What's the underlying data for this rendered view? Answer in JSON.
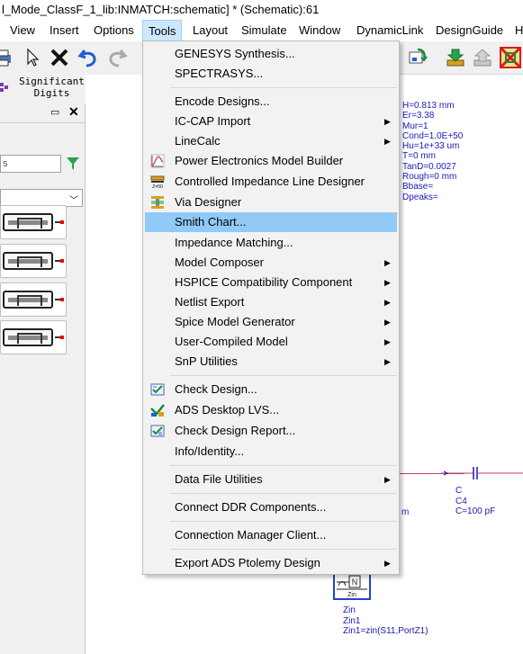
{
  "window": {
    "title": "l_Mode_ClassF_1_lib:INMATCH:schematic] * (Schematic):61"
  },
  "menubar": {
    "items": [
      {
        "label": "View"
      },
      {
        "label": "Insert"
      },
      {
        "label": "Options"
      },
      {
        "label": "Tools"
      },
      {
        "label": "Layout"
      },
      {
        "label": "Simulate"
      },
      {
        "label": "Window"
      },
      {
        "label": "DynamicLink"
      },
      {
        "label": "DesignGuide"
      },
      {
        "label": "H"
      }
    ],
    "active": "Tools"
  },
  "toolbar": {
    "significant_digits_label": "Significant\nDigits"
  },
  "panel": {
    "search_value": "s"
  },
  "tools_menu": {
    "items": [
      {
        "label": "GENESYS Synthesis...",
        "submenu": false
      },
      {
        "label": "SPECTRASYS...",
        "submenu": false
      },
      {
        "label": "Encode Designs...",
        "submenu": false
      },
      {
        "label": "IC-CAP Import",
        "submenu": true
      },
      {
        "label": "LineCalc",
        "submenu": true
      },
      {
        "label": "Power Electronics Model Builder",
        "submenu": false,
        "icon": "power-electronics-icon"
      },
      {
        "label": "Controlled Impedance Line Designer",
        "submenu": false,
        "icon": "impedance-line-icon"
      },
      {
        "label": "Via Designer",
        "submenu": false,
        "icon": "via-designer-icon"
      },
      {
        "label": "Smith Chart...",
        "submenu": false,
        "highlighted": true
      },
      {
        "label": "Impedance Matching...",
        "submenu": false
      },
      {
        "label": "Model Composer",
        "submenu": true
      },
      {
        "label": "HSPICE Compatibility Component",
        "submenu": true
      },
      {
        "label": "Netlist Export",
        "submenu": true
      },
      {
        "label": "Spice Model Generator",
        "submenu": true
      },
      {
        "label": "User-Compiled Model",
        "submenu": true
      },
      {
        "label": "SnP Utilities",
        "submenu": true
      },
      {
        "label": "Check Design...",
        "submenu": false,
        "icon": "check-design-icon"
      },
      {
        "label": "ADS Desktop LVS...",
        "submenu": false,
        "icon": "lvs-icon"
      },
      {
        "label": "Check Design Report...",
        "submenu": false,
        "icon": "check-report-icon"
      },
      {
        "label": "Info/Identity...",
        "submenu": false
      },
      {
        "label": "Data File Utilities",
        "submenu": true
      },
      {
        "label": "Connect DDR Components...",
        "submenu": false
      },
      {
        "label": "Connection Manager Client...",
        "submenu": false
      },
      {
        "label": "Export ADS Ptolemy Design",
        "submenu": true
      }
    ]
  },
  "schematic": {
    "substrate_params": [
      "H=0.813 mm",
      "Er=3.38",
      "Mur=1",
      "Cond=1.0E+50",
      "Hu=1e+33 um",
      "T=0 mm",
      "TanD=0.0027",
      "Rough=0 mm",
      "Bbase=",
      "Dpeaks="
    ],
    "capacitor": {
      "type": "C",
      "name": "C4",
      "value": "C=100 pF"
    },
    "partial_text": "m",
    "zin": {
      "box_label": "N",
      "box_sub": "Zin",
      "type": "Zin",
      "name": "Zin1",
      "expr": "Zin1=zin(S11,PortZ1)"
    }
  },
  "colors": {
    "menu_highlight": "#91c9f7",
    "menubar_active": "#cce8ff",
    "param_text": "#1a1ab4",
    "wire": "#c23a6e"
  }
}
